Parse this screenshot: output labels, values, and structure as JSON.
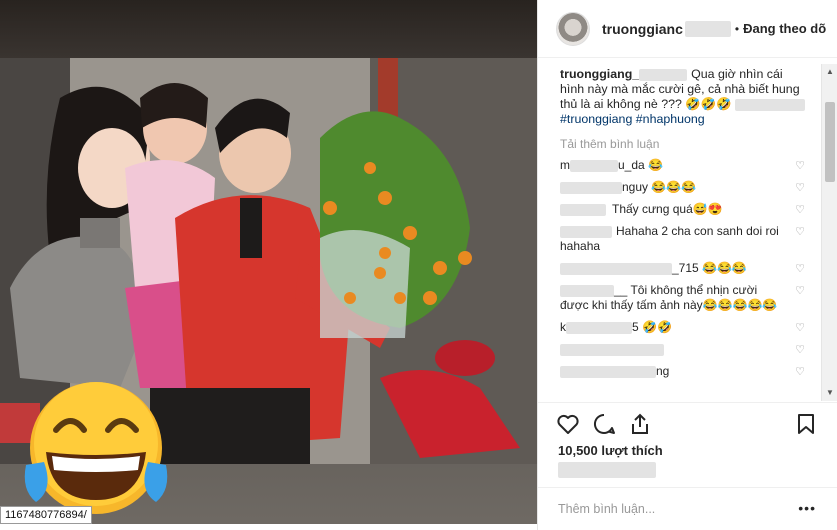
{
  "header": {
    "username": "truonggianc",
    "separator": "•",
    "follow_label": "Đang theo dõ"
  },
  "caption": {
    "username": "truonggiang_",
    "text": "Qua giờ nhìn cái hình này mà mắc cười gê, cả nhà biết hung thủ là ai không nè ??? 🤣🤣🤣",
    "tags": "#truonggiang #nhaphuong"
  },
  "load_more": "Tải thêm bình luận",
  "comments": [
    {
      "user": "m",
      "text": "u_da 😂"
    },
    {
      "user": "",
      "text": "nguy 😂😂😂"
    },
    {
      "user": "",
      "text": "Thấy cưng quá😅😍"
    },
    {
      "user": "",
      "text": "Hahaha 2 cha con sanh doi roi hahaha"
    },
    {
      "user": "",
      "text": "_715 😂😂😂"
    },
    {
      "user": "",
      "text": "__ Tôi không thể nhịn cười được khi thấy tấm ảnh này😂😂😂😂😂"
    },
    {
      "user": "k",
      "text": "5 🤣🤣"
    },
    {
      "user": "",
      "text": ""
    },
    {
      "user": "",
      "text": "ng"
    }
  ],
  "likes": "10,500 lượt thích",
  "add_comment_placeholder": "Thêm bình luận...",
  "more_options": "•••",
  "url_tag": "1167480776894/",
  "icons": [
    "heart-icon",
    "comment-icon",
    "share-icon",
    "bookmark-icon",
    "laughing-emoji-icon"
  ]
}
